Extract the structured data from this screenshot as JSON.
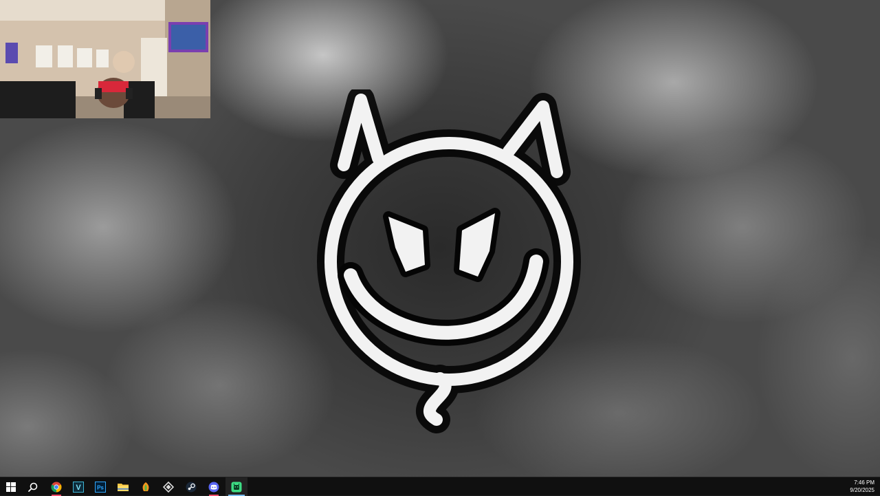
{
  "desktop": {
    "wallpaper": "black-and-white smoke background with devil smiley face",
    "colors": {
      "logo_fill": "#f2f2f2",
      "logo_outline": "#050505",
      "smoke": "#bdbdbd"
    }
  },
  "webcam": {
    "label": "webcam overlay"
  },
  "taskbar": {
    "background": "#101010",
    "items": [
      {
        "name": "start-button",
        "icon": "windows-logo-icon"
      },
      {
        "name": "search-button",
        "icon": "search-icon"
      },
      {
        "name": "chrome-app",
        "icon": "chrome-icon",
        "running": true
      },
      {
        "name": "v-app",
        "icon": "v-app-icon",
        "text": "V"
      },
      {
        "name": "photoshop-app",
        "icon": "photoshop-icon",
        "text": "Ps"
      },
      {
        "name": "file-explorer-app",
        "icon": "folder-icon"
      },
      {
        "name": "fl-studio-app",
        "icon": "fl-studio-icon"
      },
      {
        "name": "app-diamond",
        "icon": "diamond-app-icon"
      },
      {
        "name": "steam-app",
        "icon": "steam-icon"
      },
      {
        "name": "discord-canary-app",
        "icon": "discord-icon",
        "running": true
      },
      {
        "name": "android-app",
        "icon": "android-app-icon",
        "active": true
      }
    ],
    "clock": {
      "time": "7:46 PM",
      "date": "9/20/2025"
    }
  }
}
